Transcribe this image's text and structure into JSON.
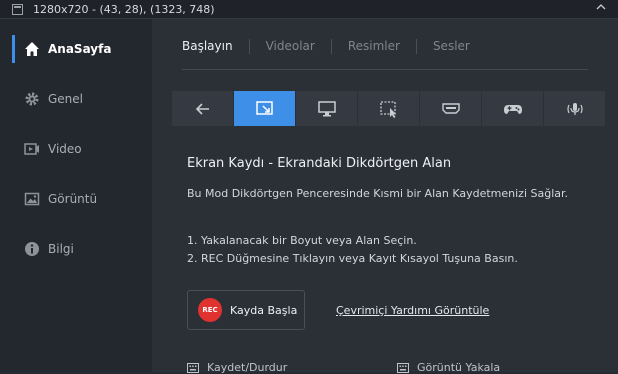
{
  "titlebar": {
    "title": "1280x720 - (43, 28), (1323, 748)"
  },
  "sidebar": {
    "items": [
      {
        "label": "AnaSayfa",
        "icon": "home-icon"
      },
      {
        "label": "Genel",
        "icon": "gear-icon"
      },
      {
        "label": "Video",
        "icon": "video-icon"
      },
      {
        "label": "Görüntü",
        "icon": "image-icon"
      },
      {
        "label": "Bilgi",
        "icon": "info-icon"
      }
    ]
  },
  "tabs": [
    "Başlayın",
    "Videolar",
    "Resimler",
    "Sesler"
  ],
  "modes": [
    "back-arrow-icon",
    "rectangle-region-icon",
    "fullscreen-monitor-icon",
    "area-select-icon",
    "hdmi-icon",
    "gamepad-icon",
    "audio-icon"
  ],
  "content": {
    "heading": "Ekran Kaydı - Ekrandaki Dikdörtgen Alan",
    "description": "Bu Mod Dikdörtgen Penceresinde Kısmi bir Alan Kaydetmenizi Sağlar.",
    "step1": "1. Yakalanacak bir Boyut veya Alan Seçin.",
    "step2": "2. REC Düğmesine Tıklayın veya Kayıt Kısayol Tuşuna Basın.",
    "rec_badge": "REC",
    "rec_button": "Kayda Başla",
    "help_link": "Çevrimiçi Yardımı Görüntüle",
    "shortcut1": "Kaydet/Durdur",
    "shortcut2": "Görüntü Yakala"
  },
  "colors": {
    "accent": "#3d8fe8",
    "rec": "#e0322f"
  }
}
